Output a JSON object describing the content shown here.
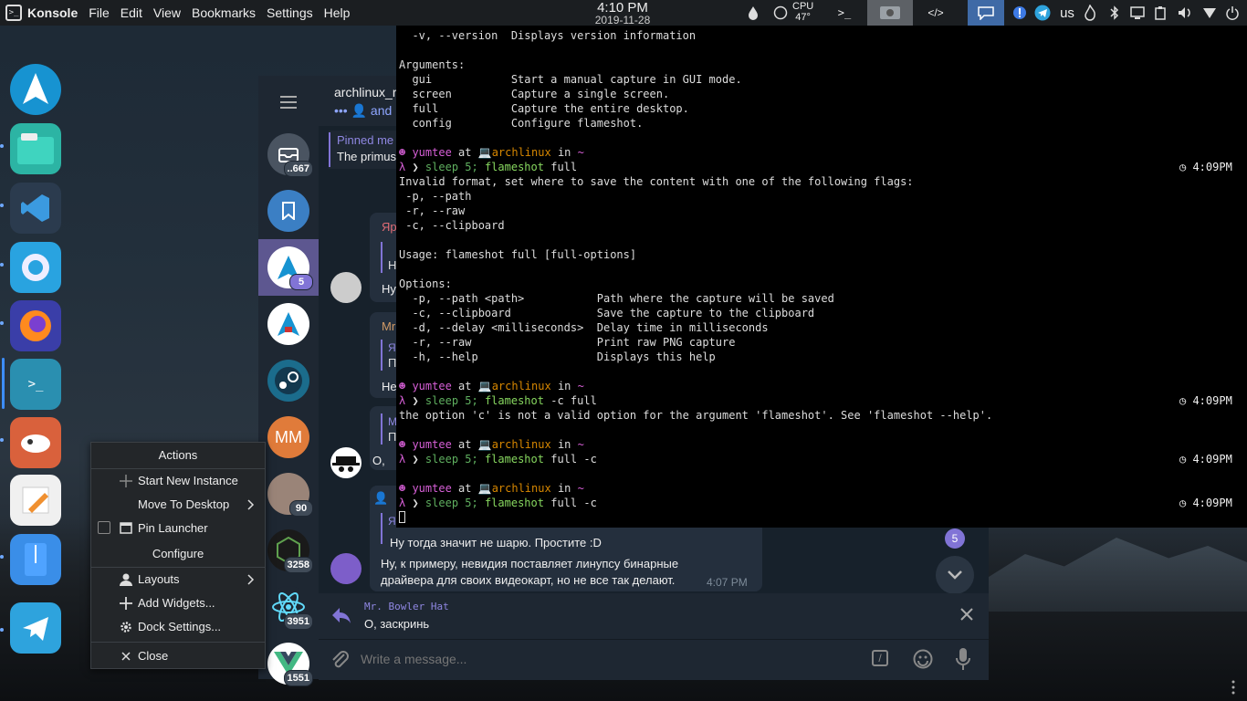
{
  "panel": {
    "app_name": "Konsole",
    "menu": [
      "File",
      "Edit",
      "View",
      "Bookmarks",
      "Settings",
      "Help"
    ],
    "clock_time": "4:10 PM",
    "clock_date": "2019-11-28",
    "cpu_label": "CPU",
    "cpu_temp": "47°",
    "keyboard_layout": "us"
  },
  "context_menu": {
    "header": "Actions",
    "start_new_instance": "Start New Instance",
    "move_to_desktop": "Move To Desktop",
    "pin_launcher": "Pin Launcher",
    "configure_header": "Configure",
    "layouts": "Layouts",
    "add_widgets": "Add Widgets...",
    "dock_settings": "Dock Settings...",
    "close": "Close"
  },
  "telegram": {
    "chat_title": "archlinux_r",
    "chat_status": "••• 👤 and",
    "pinned_label": "Pinned me",
    "pinned_text": "The primus",
    "badges": {
      "saved": "..667",
      "arch": "5",
      "mm_initials": "MM",
      "photo": "90",
      "node": "3258",
      "react": "3951",
      "vue": "1551"
    },
    "snippets": [
      "Яр",
      "Н",
      "Ну",
      "Mr",
      "Я",
      "П",
      "Не",
      "M",
      "П",
      "О,",
      "Я"
    ],
    "last_message_line1": "Ну тогда значит не шарю. Простите :D",
    "last_message_line2": "Ну, к примеру, невидия поставляет линупсу бинарные",
    "last_message_line3": "драйвера для своих видеокарт, но не все так делают.",
    "last_message_time": "4:07 PM",
    "unread_count": "5",
    "reply_author": "Mr. Bowler Hat",
    "reply_text": "О, заскринь",
    "input_placeholder": "Write a message..."
  },
  "konsole": {
    "lines": [
      "  -v, --version  Displays version information",
      "",
      "Arguments:",
      "  gui            Start a manual capture in GUI mode.",
      "  screen         Capture a single screen.",
      "  full           Capture the entire desktop.",
      "  config         Configure flameshot.",
      ""
    ],
    "user": "yumtee",
    "at": "at",
    "host": "archlinux",
    "in": "in",
    "path": "~",
    "prompt": "λ",
    "sleep_cmd": "sleep 5;",
    "cmd_flameshot": "flameshot",
    "cmd1_args": "full",
    "cmd2_args": "-c full",
    "cmd3_args": "full -c",
    "timestamp": "4:09PM",
    "out1": [
      "Invalid format, set where to save the content with one of the following flags:",
      " -p, --path",
      " -r, --raw",
      " -c, --clipboard",
      "",
      "Usage: flameshot full [full-options]",
      "",
      "Options:",
      "  -p, --path <path>           Path where the capture will be saved",
      "  -c, --clipboard             Save the capture to the clipboard",
      "  -d, --delay <milliseconds>  Delay time in milliseconds",
      "  -r, --raw                   Print raw PNG capture",
      "  -h, --help                  Displays this help",
      ""
    ],
    "out2": "the option 'c' is not a valid option for the argument 'flameshot'. See 'flameshot --help'."
  },
  "colors": {
    "accent_purple": "#8174d6",
    "terminal_bg": "#000000",
    "tg_bg": "#17212b",
    "panel_bg": "#1b1e21"
  }
}
